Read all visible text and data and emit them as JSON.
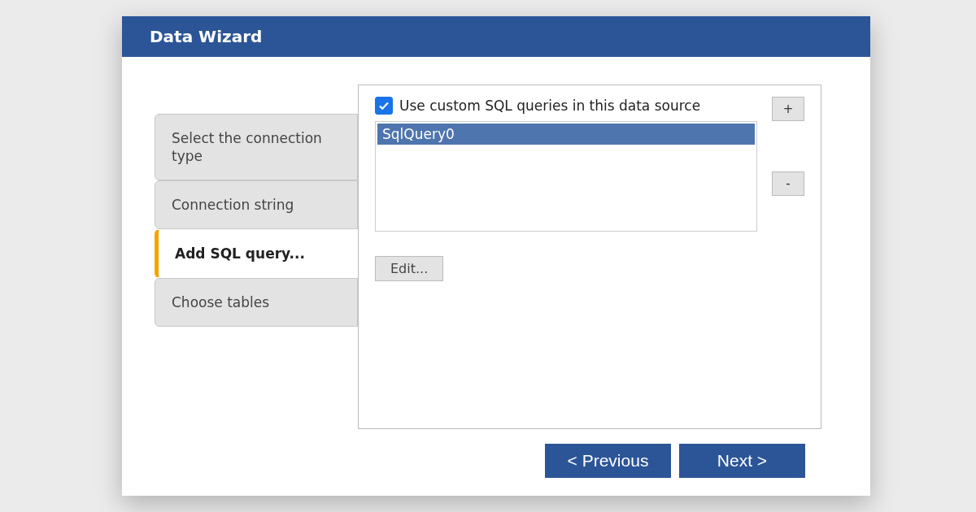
{
  "window": {
    "title": "Data Wizard"
  },
  "steps": [
    {
      "label": "Select the connection type",
      "selected": false
    },
    {
      "label": "Connection string",
      "selected": false
    },
    {
      "label": "Add SQL query...",
      "selected": true
    },
    {
      "label": "Choose tables",
      "selected": false
    }
  ],
  "custom_sql": {
    "label": "Use custom SQL queries in this data source",
    "checked": true
  },
  "queries": [
    {
      "label": "SqlQuery0",
      "selected": true
    }
  ],
  "side_buttons": [
    "+",
    "-"
  ],
  "edit_button": "Edit...",
  "buttons": [
    "< Previous",
    "Next >"
  ]
}
